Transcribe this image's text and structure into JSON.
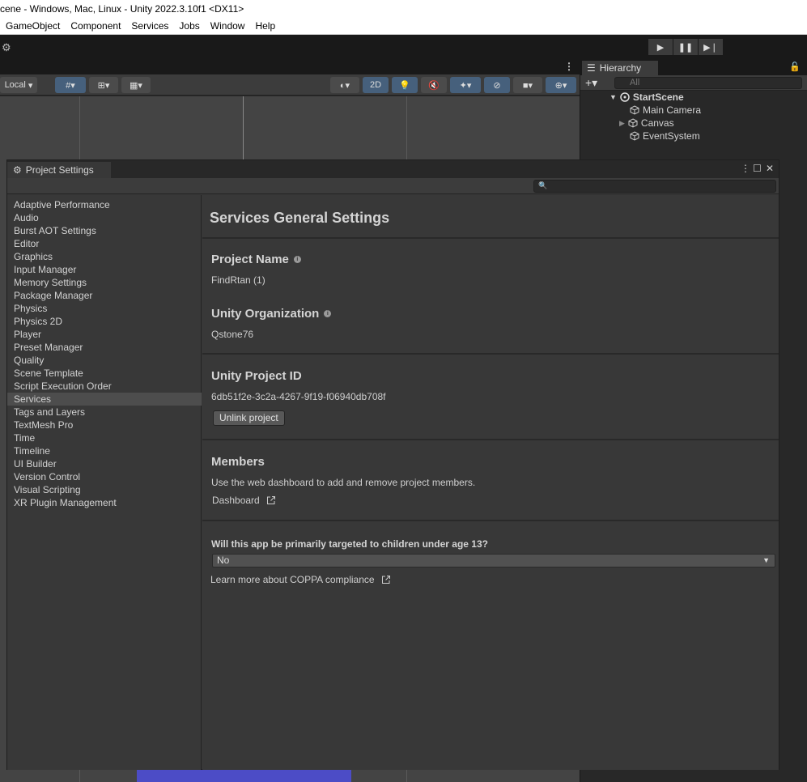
{
  "window": {
    "title": "cene - Windows, Mac, Linux - Unity 2022.3.10f1 <DX11>"
  },
  "menu": {
    "items": [
      "GameObject",
      "Component",
      "Services",
      "Jobs",
      "Window",
      "Help"
    ]
  },
  "scene_toolbar": {
    "pivot_label": "Local",
    "mode_2d": "2D"
  },
  "hierarchy": {
    "tab_label": "Hierarchy",
    "search_placeholder": "All",
    "scene": "StartScene",
    "objects": [
      "Main Camera",
      "Canvas",
      "EventSystem"
    ]
  },
  "settings": {
    "tab_label": "Project Settings",
    "nav": [
      "Adaptive Performance",
      "Audio",
      "Burst AOT Settings",
      "Editor",
      "Graphics",
      "Input Manager",
      "Memory Settings",
      "Package Manager",
      "Physics",
      "Physics 2D",
      "Player",
      "Preset Manager",
      "Quality",
      "Scene Template",
      "Script Execution Order",
      "Services",
      "Tags and Layers",
      "TextMesh Pro",
      "Time",
      "Timeline",
      "UI Builder",
      "Version Control",
      "Visual Scripting",
      "XR Plugin Management"
    ],
    "selected": "Services",
    "title": "Services General Settings",
    "project_name_label": "Project Name",
    "project_name": "FindRtan (1)",
    "org_label": "Unity Organization",
    "org": "Qstone76",
    "project_id_label": "Unity Project ID",
    "project_id": "6db51f2e-3c2a-4267-9f19-f06940db708f",
    "unlink_button": "Unlink project",
    "members_label": "Members",
    "members_desc": "Use the web dashboard to add and remove project members.",
    "dashboard_link": "Dashboard",
    "coppa_question": "Will this app be primarily targeted to children under age 13?",
    "coppa_value": "No",
    "coppa_link": "Learn more about COPPA compliance"
  }
}
